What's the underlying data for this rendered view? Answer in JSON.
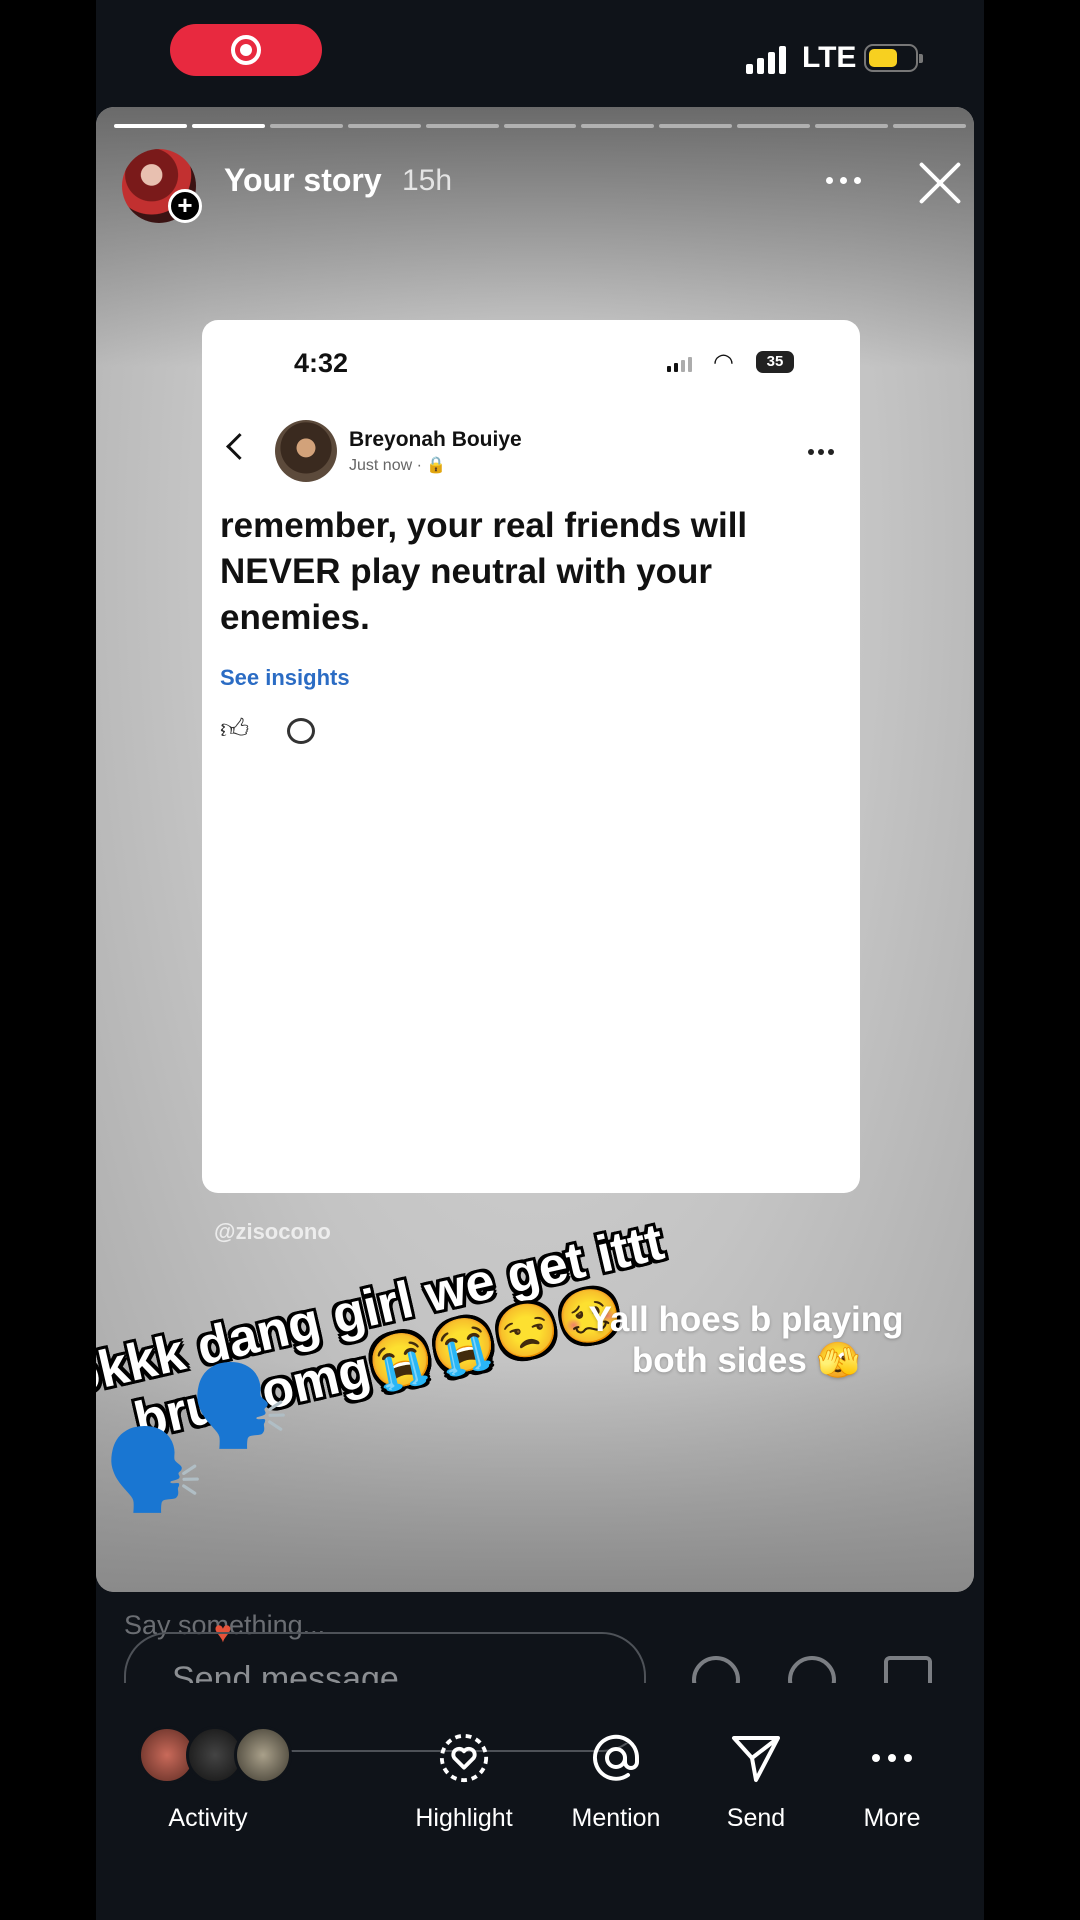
{
  "status_bar": {
    "network": "LTE"
  },
  "story": {
    "username": "Your story",
    "age": "15h",
    "progress": {
      "segments": 11,
      "current": 2
    }
  },
  "screenshot": {
    "time": "4:32",
    "battery": "35",
    "author": "Breyonah Bouiye",
    "meta": "Just now · 🔒",
    "post_text": "remember, your real friends will NEVER play neutral with your enemies.",
    "insights_label": "See insights"
  },
  "overlay": {
    "watermark": "@zisocono",
    "caption_main": "okkk dang girl we get ittt bruh omg😭😭😒🥴",
    "caption_side": "Yall hoes b playing both sides 🫣",
    "speak_emoji": "🗣️"
  },
  "reply": {
    "say_placeholder": "Say something...",
    "message_placeholder": "Send message"
  },
  "bottom_bar": {
    "activity": "Activity",
    "highlight": "Highlight",
    "mention": "Mention",
    "send": "Send",
    "more": "More"
  }
}
